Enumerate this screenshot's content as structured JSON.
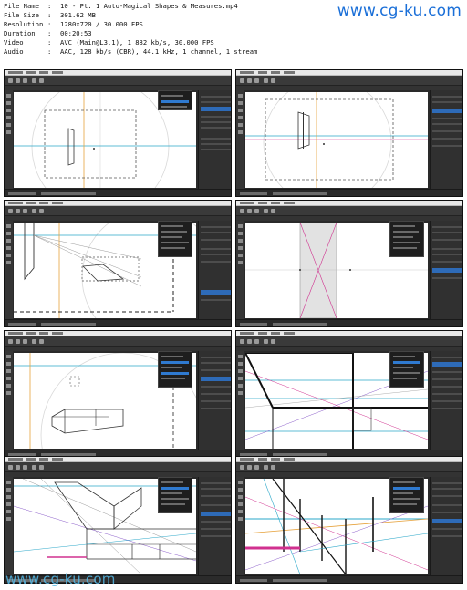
{
  "file_info": [
    {
      "key": "File Name",
      "value": "10 - Pt. 1 Auto-Magical Shapes & Measures.mp4"
    },
    {
      "key": "File Size",
      "value": "301.62 MB"
    },
    {
      "key": "Resolution",
      "value": "1280x720 / 30.000 FPS"
    },
    {
      "key": "Duration",
      "value": "00:20:53"
    },
    {
      "key": "Video",
      "value": "AVC (Main@L3.1), 1 882 kb/s, 30.000 FPS"
    },
    {
      "key": "Audio",
      "value": "AAC, 128 kb/s (CBR), 44.1 kHz, 1 channel, 1 stream"
    }
  ],
  "separator": ":",
  "watermark_top": "www.cg-ku.com",
  "watermark_bottom": "www.cg-ku.com",
  "thumbnails": [
    {
      "name": "frame-1",
      "content": "rectangle-selection"
    },
    {
      "name": "frame-2",
      "content": "rectangle-selection-guides"
    },
    {
      "name": "frame-3",
      "content": "perspective-box"
    },
    {
      "name": "frame-4",
      "content": "rectangle-guides"
    },
    {
      "name": "frame-5",
      "content": "perspective-block"
    },
    {
      "name": "frame-6",
      "content": "perspective-lines"
    },
    {
      "name": "frame-7",
      "content": "perspective-building"
    },
    {
      "name": "frame-8",
      "content": "perspective-pillars"
    }
  ],
  "colors": {
    "watermark_top": "#1a6fd8",
    "watermark_bottom": "#55b9e6",
    "app_dark": "#2a2a2a",
    "selection_blue": "#2e6bb8",
    "guide_cyan": "#2aa7c9",
    "guide_orange": "#e6a23c",
    "guide_magenta": "#d0318f"
  }
}
